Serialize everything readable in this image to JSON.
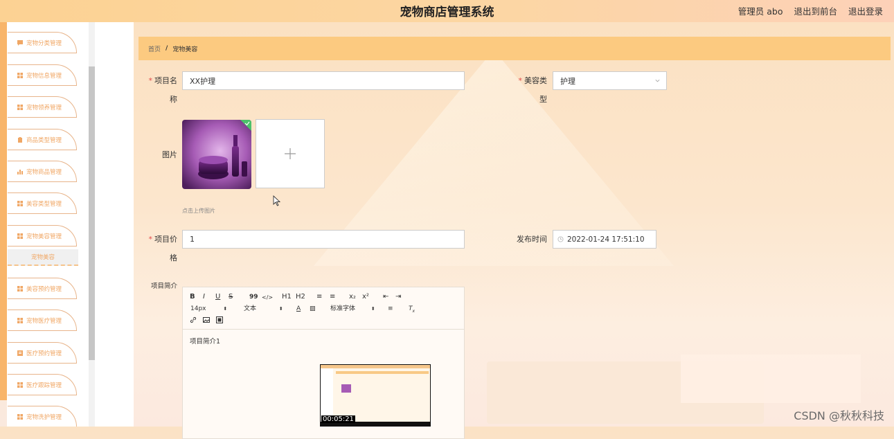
{
  "header": {
    "title": "宠物商店管理系统",
    "user_label": "管理员 abo",
    "front_link": "退出到前台",
    "logout_link": "退出登录"
  },
  "sidebar": {
    "items": [
      {
        "label": "宠物分类管理",
        "icon": "comment-icon"
      },
      {
        "label": "宠物信息管理",
        "icon": "grid-icon"
      },
      {
        "label": "宠物领养管理",
        "icon": "grid-icon"
      },
      {
        "label": "商品类型管理",
        "icon": "clipboard-icon"
      },
      {
        "label": "宠物商品管理",
        "icon": "bar-chart-icon"
      },
      {
        "label": "美容类型管理",
        "icon": "grid-icon"
      },
      {
        "label": "宠物美容管理",
        "icon": "grid-icon"
      },
      {
        "label": "美容预约管理",
        "icon": "grid-icon"
      },
      {
        "label": "宠物医疗管理",
        "icon": "grid-icon"
      },
      {
        "label": "医疗预约管理",
        "icon": "document-icon"
      },
      {
        "label": "医疗跟踪管理",
        "icon": "grid-icon"
      },
      {
        "label": "宠物洗护管理",
        "icon": "grid-icon"
      }
    ],
    "submenu_active": "宠物美容"
  },
  "breadcrumb": {
    "home": "首页",
    "separator": "/",
    "current": "宠物美容"
  },
  "form": {
    "name_label_1": "项目名",
    "name_label_2": "称",
    "name_value": "XX护理",
    "type_label_1": "美容类",
    "type_label_2": "型",
    "type_value": "护理",
    "image_label": "图片",
    "upload_hint": "点击上传图片",
    "price_label_1": "项目价",
    "price_label_2": "格",
    "price_value": "1",
    "time_label": "发布时间",
    "time_value": "2022-01-24 17:51:10",
    "intro_label": "项目简介",
    "required_mark": "*"
  },
  "editor": {
    "toolbar": {
      "bold": "B",
      "italic": "I",
      "underline": "U",
      "strike": "S",
      "quote": "99",
      "code": "</>",
      "h1": "H1",
      "h2": "H2",
      "ordered_list": "≡",
      "bullet_list": "≡",
      "subscript": "x₂",
      "superscript": "x²",
      "outdent": "⇤",
      "indent": "⇥",
      "font_size": "14px",
      "text_type": "文本",
      "font_family": "标准字体",
      "link": "link-icon",
      "image": "image-icon",
      "video": "video-icon"
    },
    "content": "项目简介1"
  },
  "video": {
    "timestamp": "00:05:21"
  },
  "watermark": "CSDN @秋秋科技",
  "colors": {
    "header_bg": "#fcd293",
    "sidebar_strip": "#f8b56a",
    "menu_text": "#f0a765",
    "breadcrumb_bg": "#fcca80",
    "required": "#e34a4a"
  }
}
